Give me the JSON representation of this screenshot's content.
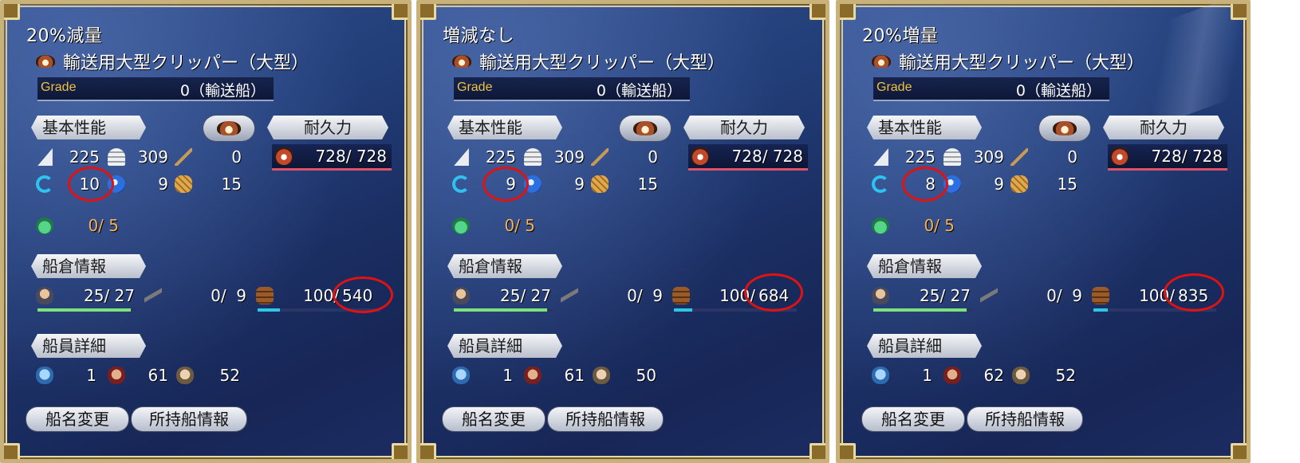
{
  "panels": [
    {
      "title": "20%減量",
      "ship_name": "輸送用大型クリッパー（大型）",
      "grade_label": "Grade",
      "grade_value": "0（輸送船）",
      "basic_label": "基本性能",
      "durability_label": "耐久力",
      "durability": "728/ 728",
      "vertical_sail": "225",
      "horizontal_sail": "309",
      "rowing": "0",
      "turning": "10",
      "wave_resistance": "9",
      "armor": "15",
      "medals": "0/ 5",
      "hold_label": "船倉情報",
      "crew_capacity": "25/ 27",
      "cannons": "0/  9",
      "cargo_current": "100/",
      "cargo_max": "540",
      "crew_detail_label": "船員詳細",
      "crew_sailors": "1",
      "crew_fighters": "61",
      "crew_navigators": "52",
      "rename_button": "船名変更",
      "owned_ships_button": "所持船情報",
      "crew_fill": 0.93,
      "cargo_fill": 0.18
    },
    {
      "title": "増減なし",
      "ship_name": "輸送用大型クリッパー（大型）",
      "grade_label": "Grade",
      "grade_value": "0（輸送船）",
      "basic_label": "基本性能",
      "durability_label": "耐久力",
      "durability": "728/ 728",
      "vertical_sail": "225",
      "horizontal_sail": "309",
      "rowing": "0",
      "turning": "9",
      "wave_resistance": "9",
      "armor": "15",
      "medals": "0/ 5",
      "hold_label": "船倉情報",
      "crew_capacity": "25/ 27",
      "cannons": "0/  9",
      "cargo_current": "100/",
      "cargo_max": "684",
      "crew_detail_label": "船員詳細",
      "crew_sailors": "1",
      "crew_fighters": "61",
      "crew_navigators": "50",
      "rename_button": "船名変更",
      "owned_ships_button": "所持船情報",
      "crew_fill": 0.93,
      "cargo_fill": 0.15
    },
    {
      "title": "20%増量",
      "ship_name": "輸送用大型クリッパー（大型）",
      "grade_label": "Grade",
      "grade_value": "0（輸送船）",
      "basic_label": "基本性能",
      "durability_label": "耐久力",
      "durability": "728/ 728",
      "vertical_sail": "225",
      "horizontal_sail": "309",
      "rowing": "0",
      "turning": "8",
      "wave_resistance": "9",
      "armor": "15",
      "medals": "0/ 5",
      "hold_label": "船倉情報",
      "crew_capacity": "25/ 27",
      "cannons": "0/  9",
      "cargo_current": "100/",
      "cargo_max": "835",
      "crew_detail_label": "船員詳細",
      "crew_sailors": "1",
      "crew_fighters": "62",
      "crew_navigators": "52",
      "rename_button": "船名変更",
      "owned_ships_button": "所持船情報",
      "crew_fill": 0.93,
      "cargo_fill": 0.12
    }
  ],
  "colors": {
    "panel_bg": "#1b2f64",
    "frame_gold": "#c8b27a",
    "highlight_circle": "#e01212",
    "grade_label": "#f0c243",
    "durability_bar": "#e05268",
    "crew_bar": "#7ee27a",
    "cargo_bar": "#2fc7e3",
    "medal_value": "#f3b15a"
  },
  "icons": [
    "ship-icon",
    "sail-vertical-icon",
    "sail-horizontal-icon",
    "oar-icon",
    "turn-icon",
    "wave-icon",
    "armor-icon",
    "medal-icon",
    "crew-icon",
    "cannon-icon",
    "barrel-icon",
    "sailor-icon",
    "fighter-icon",
    "navigator-icon"
  ]
}
